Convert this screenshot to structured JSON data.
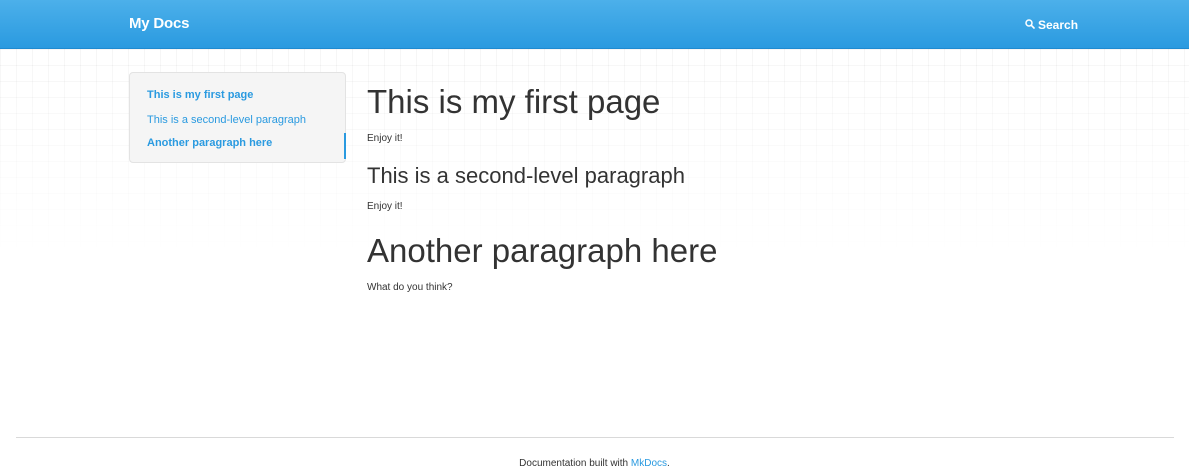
{
  "navbar": {
    "brand": "My Docs",
    "search_label": "Search",
    "search_icon": "search-icon",
    "color": "#2a9ae0"
  },
  "toc": {
    "items": [
      {
        "label": "This is my first page",
        "level": 1
      },
      {
        "label": "This is a second-level paragraph",
        "level": 2
      },
      {
        "label": "Another paragraph here",
        "level": 1
      }
    ]
  },
  "main": {
    "sections": [
      {
        "heading": "This is my first page",
        "text": "Enjoy it!"
      },
      {
        "heading": "This is a second-level paragraph",
        "text": "Enjoy it!"
      },
      {
        "heading": "Another paragraph here",
        "text": "What do you think?"
      }
    ]
  },
  "footer": {
    "prefix": "Documentation built with",
    "link": "MkDocs",
    "suffix": "."
  }
}
